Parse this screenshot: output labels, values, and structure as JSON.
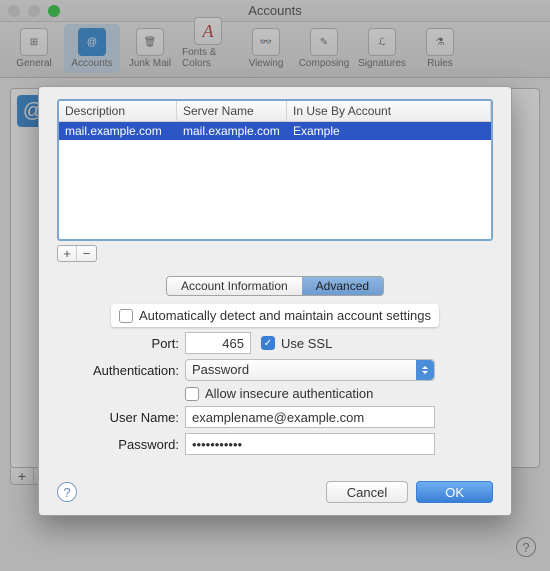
{
  "window": {
    "title": "Accounts"
  },
  "toolbar": {
    "items": [
      {
        "label": "General",
        "icon": "switch"
      },
      {
        "label": "Accounts",
        "icon": "@",
        "selected": true
      },
      {
        "label": "Junk Mail",
        "icon": "bin"
      },
      {
        "label": "Fonts & Colors",
        "icon": "A"
      },
      {
        "label": "Viewing",
        "icon": "glasses"
      },
      {
        "label": "Composing",
        "icon": "pen"
      },
      {
        "label": "Signatures",
        "icon": "sig"
      },
      {
        "label": "Rules",
        "icon": "bucket"
      }
    ]
  },
  "sheet": {
    "table": {
      "headers": [
        "Description",
        "Server Name",
        "In Use By Account"
      ],
      "rows": [
        {
          "description": "mail.example.com",
          "server": "mail.example.com",
          "account": "Example"
        }
      ]
    },
    "segments": {
      "info": "Account Information",
      "advanced": "Advanced",
      "active": "advanced"
    },
    "form": {
      "auto_detect_label": "Automatically detect and maintain account settings",
      "auto_detect_checked": false,
      "port_label": "Port:",
      "port_value": "465",
      "use_ssl_label": "Use SSL",
      "use_ssl_checked": true,
      "auth_label": "Authentication:",
      "auth_value": "Password",
      "allow_insecure_label": "Allow insecure authentication",
      "allow_insecure_checked": false,
      "user_label": "User Name:",
      "user_value": "examplename@example.com",
      "pass_label": "Password:",
      "pass_value": "•••••••••••"
    },
    "buttons": {
      "cancel": "Cancel",
      "ok": "OK"
    }
  }
}
